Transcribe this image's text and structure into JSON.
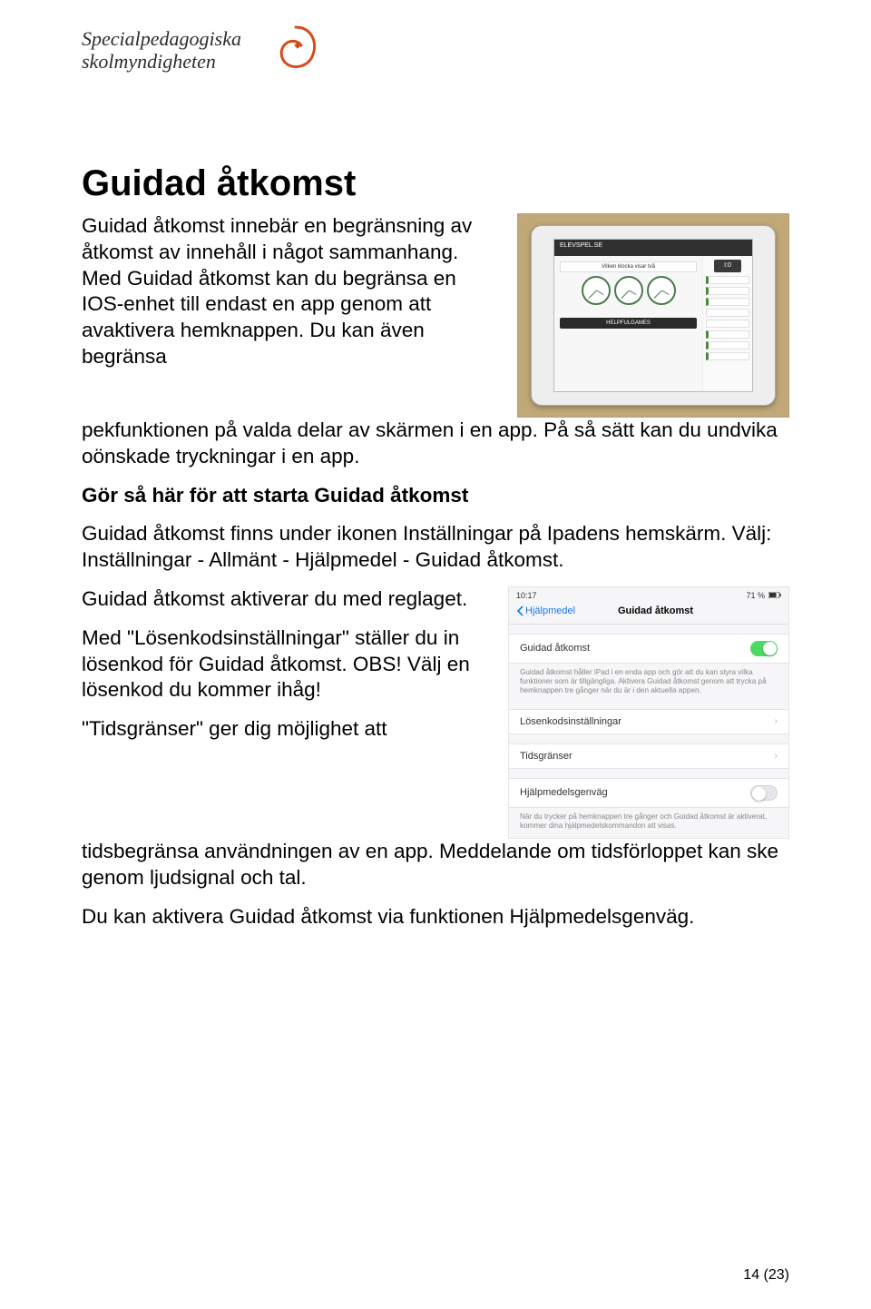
{
  "logo": {
    "line1": "Specialpedagogiska",
    "line2": "skolmyndigheten"
  },
  "title": "Guidad åtkomst",
  "intro_p1": "Guidad åtkomst innebär en begränsning av åtkomst av innehåll i något sammanhang. Med Guidad åtkomst kan du begränsa en IOS-enhet till endast en app genom att avaktivera hemknappen. Du kan även begränsa",
  "intro_p2": "pekfunktionen på valda delar av skärmen i en app. På så sätt kan du undvika oönskade tryckningar i en app.",
  "subhead": "Gör så här för att starta Guidad åtkomst",
  "p3": "Guidad åtkomst finns under ikonen Inställningar på Ipadens hemskärm. Välj: Inställningar - Allmänt - Hjälpmedel - Guidad åtkomst.",
  "p4": "Guidad åtkomst aktiverar du med reglaget.",
  "p5": "Med \"Lösenkodsinställningar\" ställer du in lösenkod för Guidad åtkomst. OBS! Välj en lösenkod du kommer ihåg!",
  "p6a": "\"Tidsgränser\" ger dig möjlighet att",
  "p6b": "tidsbegränsa användningen av en app. Meddelande om tidsförloppet kan ske genom ljudsignal och tal.",
  "p7": "Du kan aktivera Guidad åtkomst via funktionen Hjälpmedelsgenväg.",
  "ipad": {
    "site": "ELEVSPEL.SE",
    "banner": "Vilken klocka visar två",
    "helpful": "HELPFULGAMES",
    "badge": "I:0"
  },
  "settings": {
    "time": "10:17",
    "battery": "71 %",
    "back": "Hjälpmedel",
    "nav_title": "Guidad åtkomst",
    "row_main": "Guidad åtkomst",
    "caption1": "Guidad åtkomst håller iPad i en enda app och gör att du kan styra vilka funktioner som är tillgängliga. Aktivera Guidad åtkomst genom att trycka på hemknappen tre gånger när du är i den aktuella appen.",
    "row_passcode": "Lösenkodsinställningar",
    "row_time": "Tidsgränser",
    "row_shortcut": "Hjälpmedelsgenväg",
    "caption2": "När du trycker på hemknappen tre gånger och Guidad åtkomst är aktiverat, kommer dina hjälpmedelskommandon att visas."
  },
  "page_num": "14 (23)"
}
